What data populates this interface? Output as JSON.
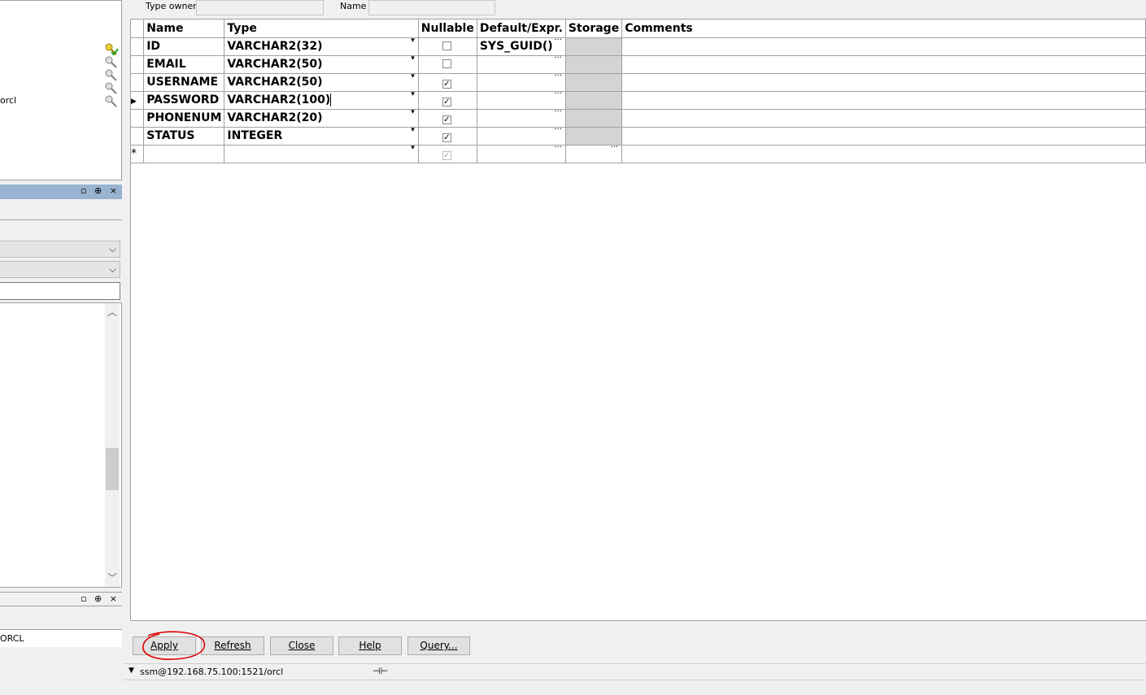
{
  "left_panel": {
    "connection_text": "orcl",
    "bottom_text": "ORCL",
    "panel_buttons": "▫ ⊕ ×"
  },
  "form": {
    "type_owner_label": "Type owner",
    "name_label": "Name",
    "type_owner_value": "",
    "name_value": ""
  },
  "grid": {
    "headers": [
      "Name",
      "Type",
      "Nullable",
      "Default/Expr.",
      "Storage",
      "Comments"
    ],
    "rows": [
      {
        "name": "ID",
        "type": "VARCHAR2(32)",
        "nullable": false,
        "default": "SYS_GUID()",
        "comments": ""
      },
      {
        "name": "EMAIL",
        "type": "VARCHAR2(50)",
        "nullable": false,
        "default": "",
        "comments": ""
      },
      {
        "name": "USERNAME",
        "type": "VARCHAR2(50)",
        "nullable": true,
        "default": "",
        "comments": ""
      },
      {
        "name": "PASSWORD",
        "type": "VARCHAR2(100)",
        "nullable": true,
        "default": "",
        "comments": ""
      },
      {
        "name": "PHONENUM",
        "type": "VARCHAR2(20)",
        "nullable": true,
        "default": "",
        "comments": ""
      },
      {
        "name": "STATUS",
        "type": "INTEGER",
        "nullable": true,
        "default": "",
        "comments": ""
      }
    ],
    "new_row_marker": "*",
    "current_row_marker": "▶",
    "ellipsis": "···",
    "dropdown_glyph": "▾"
  },
  "buttons": {
    "apply": "Apply",
    "refresh": "Refresh",
    "close": "Close",
    "help": "Help",
    "query": "Query..."
  },
  "status_bar": {
    "connection": "ssm@192.168.75.100:1521/orcl"
  },
  "colors": {
    "active_panel_header": "#99b4d1",
    "storage_disabled": "#d4d4d4",
    "annotation_red": "#e00000"
  }
}
